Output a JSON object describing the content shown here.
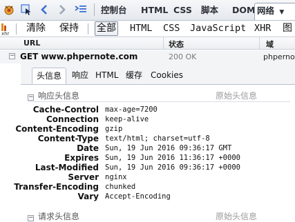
{
  "toolbar": {
    "tabs": [
      "控制台",
      "HTML",
      "CSS",
      "脚本",
      "DOM",
      "网络"
    ],
    "active_tab": "网络"
  },
  "filters": {
    "xhr_icon": "xhr",
    "clear": "清除",
    "persist": "保持",
    "all": "全部",
    "html": "HTML",
    "css": "CSS",
    "js": "JavaScript",
    "xhr": "XHR",
    "images": "图"
  },
  "columns": {
    "url": "URL",
    "status": "状态",
    "domain": "域"
  },
  "request": {
    "url": "GET www.phpernote.com",
    "status": "200 OK",
    "domain": "phpernot"
  },
  "detail": {
    "tabs": [
      "头信息",
      "响应",
      "HTML",
      "缓存",
      "Cookies"
    ],
    "active_tab": "头信息",
    "response_section": "响应头信息",
    "request_section": "请求头信息",
    "raw_label": "原始头信息",
    "headers": [
      {
        "name": "Cache-Control",
        "value": "max-age=7200"
      },
      {
        "name": "Connection",
        "value": "keep-alive"
      },
      {
        "name": "Content-Encoding",
        "value": "gzip"
      },
      {
        "name": "Content-Type",
        "value": "text/html; charset=utf-8"
      },
      {
        "name": "Date",
        "value": "Sun, 19 Jun 2016 09:36:17 GMT"
      },
      {
        "name": "Expires",
        "value": "Sun, 19 Jun 2016 11:36:17 +0000"
      },
      {
        "name": "Last-Modified",
        "value": "Sun, 19 Jun 2016 09:36:17 +0000"
      },
      {
        "name": "Server",
        "value": "nginx"
      },
      {
        "name": "Transfer-Encoding",
        "value": "chunked"
      },
      {
        "name": "Vary",
        "value": "Accept-Encoding"
      }
    ]
  },
  "colors": {
    "accent": "#3a6fd0",
    "panel": "#f3f4f6"
  }
}
